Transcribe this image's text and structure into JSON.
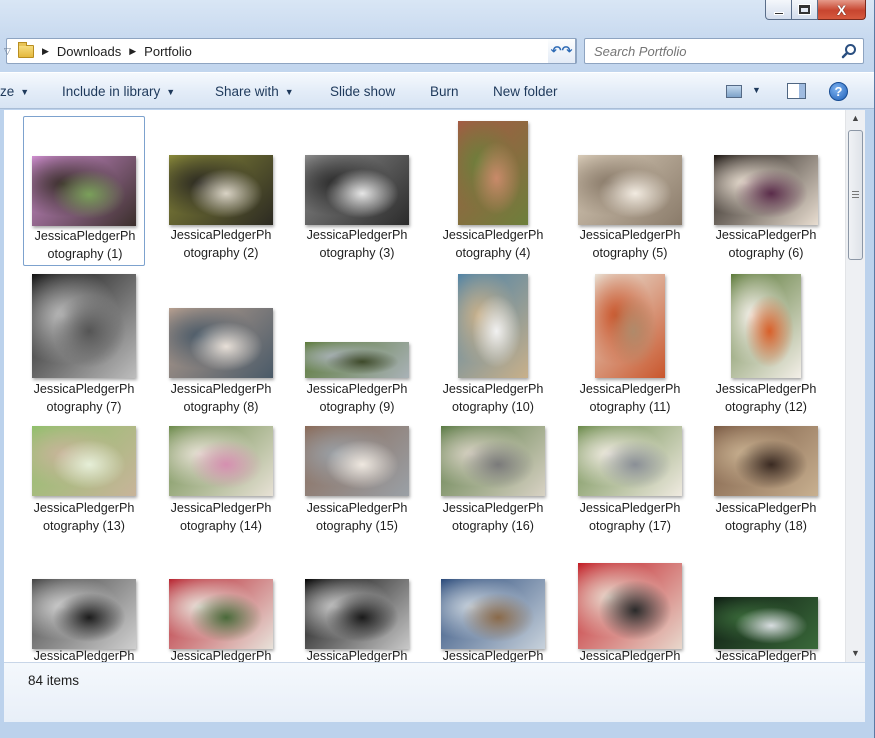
{
  "window": {
    "caption": {
      "minimize_icon": "minimize-icon",
      "maximize_icon": "maximize-icon",
      "close_glyph": "X"
    }
  },
  "address": {
    "breadcrumb": [
      "Downloads",
      "Portfolio"
    ],
    "search_placeholder": "Search Portfolio"
  },
  "toolbar": {
    "organize_partial": "ze",
    "include_in_library": "Include in library",
    "share_with": "Share with",
    "slide_show": "Slide show",
    "burn": "Burn",
    "new_folder": "New folder",
    "help_glyph": "?"
  },
  "items": [
    {
      "line1": "JessicaPledgerPh",
      "line2": "otography (1)",
      "palette": [
        "#cf8ed0",
        "#3b2f2c",
        "#7aa05a"
      ],
      "selected": true
    },
    {
      "line1": "JessicaPledgerPh",
      "line2": "otography (2)",
      "palette": [
        "#8a8a3a",
        "#2c2a22",
        "#d9d3c5"
      ]
    },
    {
      "line1": "JessicaPledgerPh",
      "line2": "otography (3)",
      "palette": [
        "#8c8c8c",
        "#2b2b2b",
        "#e6e6e6"
      ]
    },
    {
      "line1": "JessicaPledgerPh",
      "line2": "otography (4)",
      "palette": [
        "#a55a44",
        "#6d7f3b",
        "#c98a6a"
      ]
    },
    {
      "line1": "JessicaPledgerPh",
      "line2": "otography (5)",
      "palette": [
        "#d8cbb8",
        "#8a7b6a",
        "#f2ebe1"
      ]
    },
    {
      "line1": "JessicaPledgerPh",
      "line2": "otography (6)",
      "palette": [
        "#1a1410",
        "#e8ddd0",
        "#5a2c4a"
      ]
    },
    {
      "line1": "JessicaPledgerPh",
      "line2": "otography (7)",
      "palette": [
        "#111111",
        "#bdbdbd",
        "#555555"
      ]
    },
    {
      "line1": "JessicaPledgerPh",
      "line2": "otography (8)",
      "palette": [
        "#b8a090",
        "#4a5a68",
        "#e8e0d8"
      ]
    },
    {
      "line1": "JessicaPledgerPh",
      "line2": "otography (9)",
      "palette": [
        "#5c7a3a",
        "#a9b2b7",
        "#3e4a2a"
      ]
    },
    {
      "line1": "JessicaPledgerPh",
      "line2": "otography (10)",
      "palette": [
        "#4f83a6",
        "#c8b08a",
        "#f1f1f1"
      ]
    },
    {
      "line1": "JessicaPledgerPh",
      "line2": "otography (11)",
      "palette": [
        "#e9e2d6",
        "#c9562c",
        "#b08a6a"
      ]
    },
    {
      "line1": "JessicaPledgerPh",
      "line2": "otography (12)",
      "palette": [
        "#5d7a3a",
        "#f3efe8",
        "#d8602a"
      ]
    },
    {
      "line1": "JessicaPledgerPh",
      "line2": "otography (13)",
      "palette": [
        "#8fc06a",
        "#c8b49a",
        "#e6efd8"
      ]
    },
    {
      "line1": "JessicaPledgerPh",
      "line2": "otography (14)",
      "palette": [
        "#6b8a4a",
        "#e7e1d5",
        "#d58fb0"
      ]
    },
    {
      "line1": "JessicaPledgerPh",
      "line2": "otography (15)",
      "palette": [
        "#8a6a58",
        "#9aa0a6",
        "#efe8e0"
      ]
    },
    {
      "line1": "JessicaPledgerPh",
      "line2": "otography (16)",
      "palette": [
        "#5a7a44",
        "#d8d2c4",
        "#7a7a7a"
      ]
    },
    {
      "line1": "JessicaPledgerPh",
      "line2": "otography (17)",
      "palette": [
        "#6a8a4a",
        "#efeae0",
        "#8a8f96"
      ]
    },
    {
      "line1": "JessicaPledgerPh",
      "line2": "otography (18)",
      "palette": [
        "#7a5a44",
        "#c8b090",
        "#3a2a22"
      ]
    },
    {
      "line1": "JessicaPledgerPh",
      "line2": "",
      "palette": [
        "#444444",
        "#cfcfcf",
        "#1c1c1c"
      ]
    },
    {
      "line1": "JessicaPledgerPh",
      "line2": "",
      "palette": [
        "#b82430",
        "#e8e2da",
        "#4a6a3a"
      ]
    },
    {
      "line1": "JessicaPledgerPh",
      "line2": "",
      "palette": [
        "#050505",
        "#c8c8c8",
        "#1a1a1a"
      ]
    },
    {
      "line1": "JessicaPledgerPh",
      "line2": "",
      "palette": [
        "#2a4a7a",
        "#c8d2dc",
        "#8a6a4a"
      ]
    },
    {
      "line1": "JessicaPledgerPh",
      "line2": "",
      "palette": [
        "#c21c24",
        "#e8d8cc",
        "#2a2a2a"
      ]
    },
    {
      "line1": "JessicaPledgerPh",
      "line2": "",
      "palette": [
        "#0d1a12",
        "#3a6a3a",
        "#d8dde0"
      ]
    }
  ],
  "status": {
    "item_count": "84 items"
  }
}
